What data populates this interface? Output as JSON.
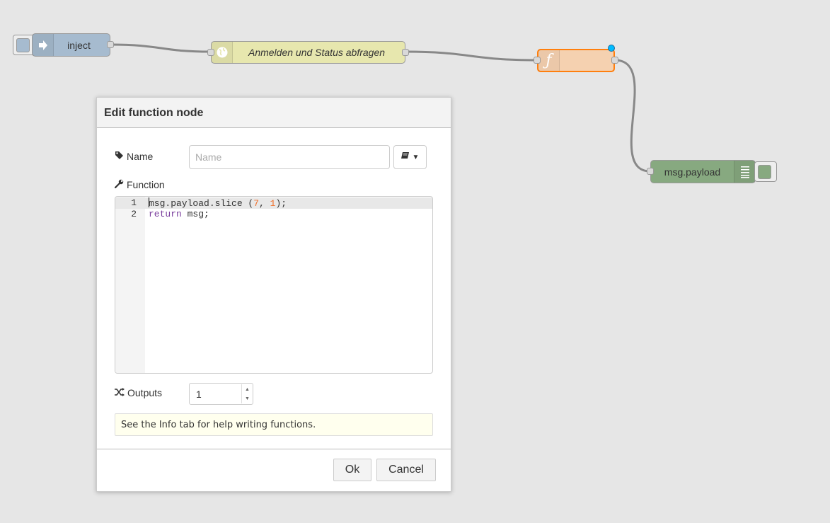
{
  "flow": {
    "inject_node": {
      "label": "inject",
      "color": "#a6bbcf"
    },
    "http_node": {
      "label": "Anmelden und Status abfragen",
      "color": "#e7e7ae"
    },
    "function_node": {
      "label": "",
      "color": "#fdd0a2",
      "icon": "function-icon"
    },
    "debug_node": {
      "label": "msg.payload",
      "color": "#87a980"
    }
  },
  "dialog": {
    "title": "Edit function node",
    "name_label": "Name",
    "name_value": "",
    "name_placeholder": "Name",
    "icon_button": "book-icon",
    "function_label": "Function",
    "code": {
      "line1_number": "1",
      "line2_number": "2",
      "line1": {
        "part1": "msg.payload.slice (",
        "num1": "7",
        "sep": ", ",
        "num2": "1",
        "part2": ");"
      },
      "line2": {
        "keyword": "return",
        "rest": " msg;"
      }
    },
    "outputs_label": "Outputs",
    "outputs_value": "1",
    "tip": "See the Info tab for help writing functions.",
    "ok_label": "Ok",
    "cancel_label": "Cancel"
  }
}
